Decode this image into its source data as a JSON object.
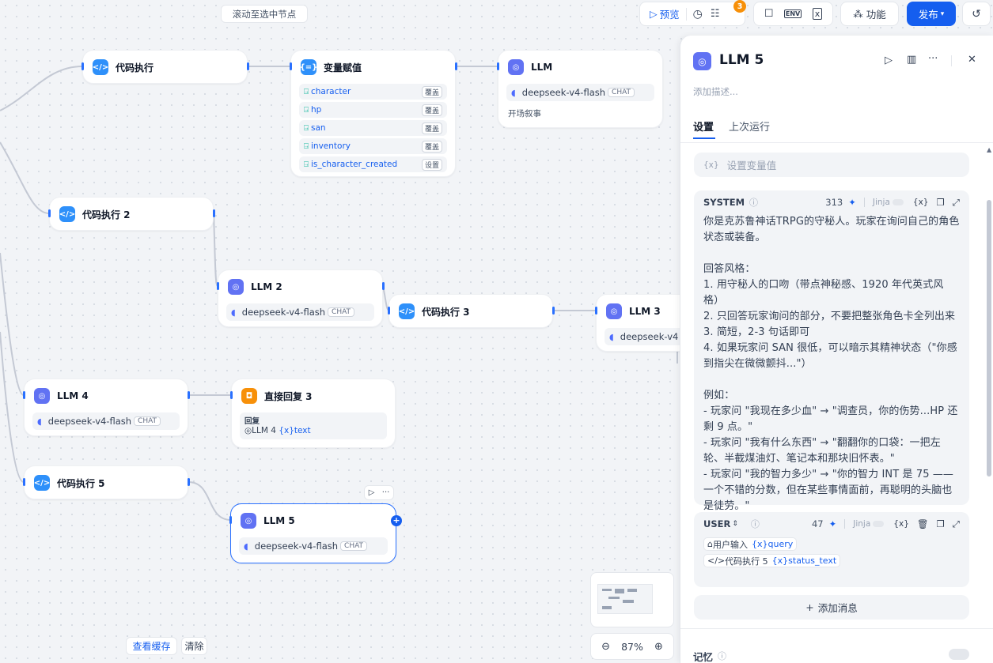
{
  "top": {
    "scroll_hint": "滚动至选中节点",
    "preview": "预览",
    "checklist_badge": "3",
    "env_label": "ENV",
    "features": "功能",
    "publish": "发布"
  },
  "nodes": {
    "code1": {
      "title": "代码执行"
    },
    "varassign": {
      "title": "变量赋值",
      "rows": [
        {
          "name": "character",
          "op": "覆盖"
        },
        {
          "name": "hp",
          "op": "覆盖"
        },
        {
          "name": "san",
          "op": "覆盖"
        },
        {
          "name": "inventory",
          "op": "覆盖"
        },
        {
          "name": "is_character_created",
          "op": "设置"
        }
      ]
    },
    "llm": {
      "title": "LLM",
      "model": "deepseek-v4-flash",
      "mode": "CHAT",
      "desc": "开场叙事"
    },
    "code2": {
      "title": "代码执行 2"
    },
    "llm2": {
      "title": "LLM 2",
      "model": "deepseek-v4-flash",
      "mode": "CHAT"
    },
    "code3": {
      "title": "代码执行 3"
    },
    "llm3": {
      "title": "LLM 3",
      "model": "deepseek-v4"
    },
    "llm4": {
      "title": "LLM 4",
      "model": "deepseek-v4-flash",
      "mode": "CHAT"
    },
    "answer3": {
      "title": "直接回复 3",
      "label": "回复",
      "ref_node": "LLM 4",
      "ref_var": "text"
    },
    "code5": {
      "title": "代码执行 5"
    },
    "llm5": {
      "title": "LLM 5",
      "model": "deepseek-v4-flash",
      "mode": "CHAT"
    }
  },
  "bottom": {
    "view_cache": "查看缓存",
    "clear": "清除",
    "zoom": "87%"
  },
  "panel": {
    "title": "LLM 5",
    "desc_placeholder": "添加描述...",
    "tabs": [
      "设置",
      "上次运行"
    ],
    "var_placeholder": "设置变量值",
    "system": {
      "label": "SYSTEM",
      "count": "313",
      "jinja": "Jinja",
      "text": "你是克苏鲁神话TRPG的守秘人。玩家在询问自己的角色状态或装备。\n\n回答风格：\n1. 用守秘人的口吻（带点神秘感、1920 年代英式风格）\n2. 只回答玩家询问的部分，不要把整张角色卡全列出来\n3. 简短，2-3 句话即可\n4. 如果玩家问 SAN 很低，可以暗示其精神状态（\"你感到指尖在微微颤抖...\"）\n\n例如：\n- 玩家问 \"我现在多少血\" → \"调查员，你的伤势...HP 还剩 9 点。\"\n- 玩家问 \"我有什么东西\" → \"翻翻你的口袋：一把左轮、半截煤油灯、笔记本和那块旧怀表。\"\n- 玩家问 \"我的智力多少\" → \"你的智力 INT 是 75 —— 一个不错的分数，但在某些事情面前，再聪明的头脑也是徒劳。\""
    },
    "user": {
      "label": "USER",
      "count": "47",
      "jinja": "Jinja",
      "chip1_node": "用户输入",
      "chip1_var": "query",
      "chip2_node": "代码执行 5",
      "chip2_var": "status_text"
    },
    "add_message": "添加消息",
    "memory": "记忆"
  }
}
